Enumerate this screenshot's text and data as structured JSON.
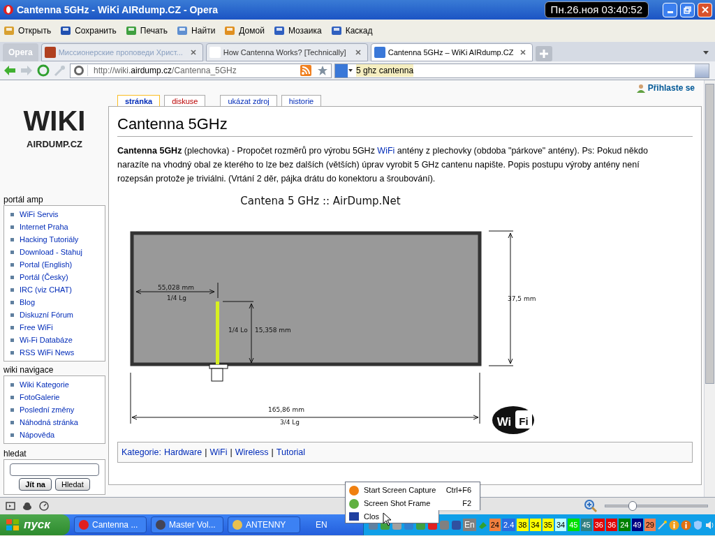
{
  "window": {
    "title": "Cantenna 5GHz - WiKi AIRdump.CZ - Opera",
    "clock": "Пн.26.ноя 03:40:52"
  },
  "toolbar": [
    "Открыть",
    "Сохранить",
    "Печать",
    "Найти",
    "Домой",
    "Мозаика",
    "Каскад"
  ],
  "opera_button": "Opera",
  "tabs": [
    {
      "label": "Миссионерские проповеди Христ...",
      "selected": false
    },
    {
      "label": "How Cantenna Works? [Technically]",
      "selected": false
    },
    {
      "label": "Cantenna 5GHz – WiKi AIRdump.CZ",
      "selected": true
    }
  ],
  "address": {
    "url_prefix": "http://wiki.",
    "url_host": "airdump.cz",
    "url_path": "/Cantenna_5GHz",
    "search": "5 ghz cantenna"
  },
  "page": {
    "login": "Přihlaste se",
    "page_tabs": [
      {
        "label": "stránka",
        "selected": true,
        "missing": false
      },
      {
        "label": "diskuse",
        "selected": false,
        "missing": true
      },
      {
        "label": "ukázat zdroj",
        "selected": false,
        "missing": false
      },
      {
        "label": "historie",
        "selected": false,
        "missing": false
      }
    ],
    "sidebar": [
      {
        "title": "portál amp",
        "items": [
          "WiFi Servis",
          "Internet Praha",
          "Hacking Tutoriály",
          "Download - Stahuj",
          "Portal (English)",
          "Portál (Česky)",
          "IRC (viz CHAT)",
          "Blog",
          "Diskuzní Fórum",
          "Free WiFi",
          "Wi-Fi Databáze",
          "RSS WiFi News"
        ]
      },
      {
        "title": "wiki navigace",
        "items": [
          "Wiki Kategorie",
          "FotoGalerie",
          "Poslední změny",
          "Náhodná stránka",
          "Nápověda"
        ]
      }
    ],
    "search": {
      "title": "hledat",
      "buttons": [
        "Jít na",
        "Hledat"
      ]
    },
    "title": "Cantenna 5GHz",
    "intro": [
      {
        "kind": "text",
        "text": "**Cantenna 5GHz** (plechovka) - Propočet rozměrů pro výrobu 5GHz "
      },
      {
        "kind": "link",
        "text": "WiFi"
      },
      {
        "kind": "text",
        "text": " antény z plechovky (obdoba \"párkove\" antény). Ps: Pokud někdo narazíte na vhodný obal ze kterého to lze bez dalších (větších) úprav vyrobit 5 GHz cantenu napište. Popis postupu výroby antény není rozepsán protože je triviálni. (Vrtání 2 děr, pájka drátu do konektoru a šroubování)."
      }
    ],
    "diagram": {
      "title": "Cantena 5 GHz :: AirDump.Net",
      "offset": "55,028 mm",
      "offset_ratio": "1/4 Lg",
      "probe_ratio": "1/4 Lo",
      "probe": "15,358 mm",
      "height": "37,5 mm",
      "length": "165,86 mm",
      "length_ratio": "3/4 Lg",
      "logo_left": "Wi",
      "logo_right": "Fi"
    },
    "categories": {
      "label": "Kategorie:",
      "items": [
        {
          "kind": "link",
          "text": "Hardware"
        },
        {
          "kind": "separator",
          "text": "|"
        },
        {
          "kind": "link",
          "text": "WiFi"
        },
        {
          "kind": "separator",
          "text": "|"
        },
        {
          "kind": "link",
          "text": "Wireless"
        },
        {
          "kind": "separator",
          "text": "|"
        },
        {
          "kind": "link",
          "text": "Tutorial"
        }
      ]
    },
    "logo": {
      "top": "WIKI",
      "bottom": "AIRDUMP.CZ"
    }
  },
  "status_bar": {
    "zoom": {
      "level": 0.27
    }
  },
  "popup_menu": [
    {
      "label": "Start Screen Capture",
      "shortcut": "Ctrl+F6"
    },
    {
      "label": "Screen Shot Frame",
      "shortcut": "F2"
    },
    {
      "label": "Clos"
    }
  ],
  "taskbar": {
    "start": "пуск",
    "tasks": [
      "Cantenna ...",
      "Master Vol...",
      "ANTENNY"
    ],
    "language": "EN",
    "tray_language": "En",
    "badges": [
      {
        "text": "24",
        "color": "#f08040"
      },
      {
        "text": "2.4",
        "color": "#2a6be0"
      },
      {
        "text": "38",
        "color": "#ffff00"
      },
      {
        "text": "34",
        "color": "#ffff00"
      },
      {
        "text": "35",
        "color": "#ffff00"
      },
      {
        "text": "34",
        "color": "#c0ffff"
      },
      {
        "text": "45",
        "color": "#00e000"
      },
      {
        "text": "45",
        "color": "#308080"
      },
      {
        "text": "36",
        "color": "#e00000"
      },
      {
        "text": "36",
        "color": "#e00000"
      },
      {
        "text": "24",
        "color": "#008000"
      },
      {
        "text": "49",
        "color": "#000080"
      },
      {
        "text": "29",
        "color": "#f08050"
      }
    ]
  }
}
